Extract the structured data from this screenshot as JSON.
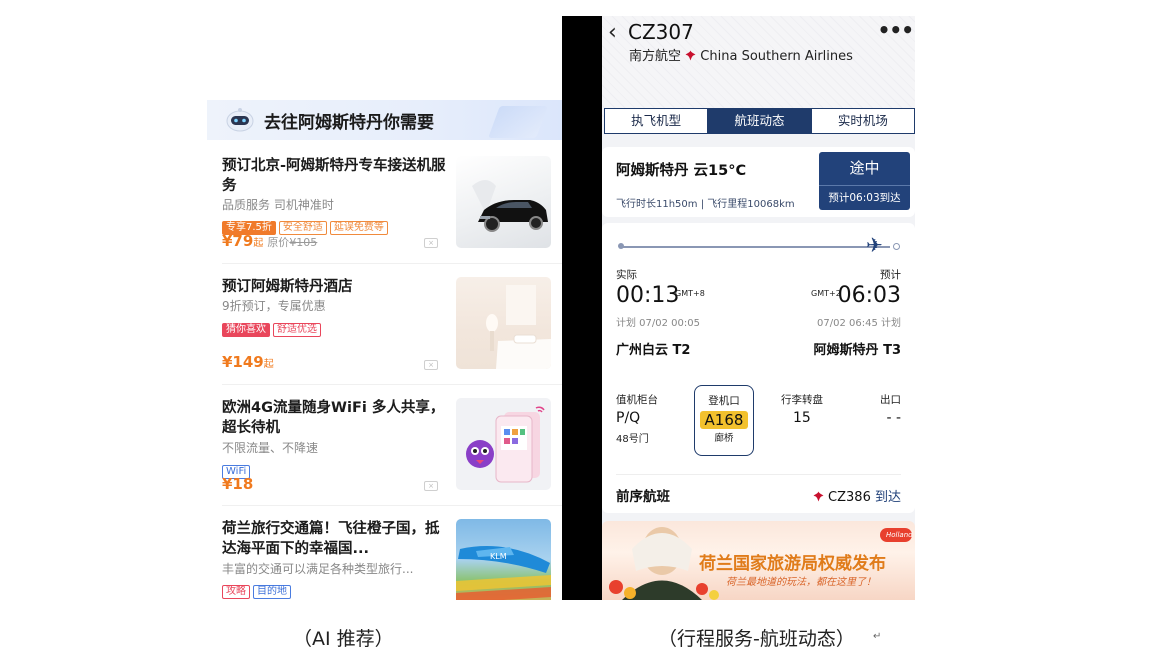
{
  "left": {
    "header_title": "去往阿姆斯特丹你需要",
    "items": [
      {
        "title": "预订北京-阿姆斯特丹专车接送机服务",
        "subtitle": "品质服务 司机神准时",
        "tags": [
          "专享7.5折",
          "安全舒适",
          "延误免费等"
        ],
        "price": "¥79",
        "price_suffix": "起",
        "old_price_label": "原价",
        "old_price": "¥105"
      },
      {
        "title": "预订阿姆斯特丹酒店",
        "subtitle": "9折预订，专属优惠",
        "tags": [
          "猜你喜欢",
          "舒适优选"
        ],
        "price": "¥149",
        "price_suffix": "起"
      },
      {
        "title": "欧洲4G流量随身WiFi 多人共享，超长待机",
        "subtitle": "不限流量、不降速",
        "tags": [
          "WiFi"
        ],
        "price": "¥18"
      },
      {
        "title": "荷兰旅行交通篇！飞往橙子国，抵达海平面下的幸福国...",
        "subtitle": "丰富的交通可以满足各种类型旅行...",
        "tags": [
          "攻略",
          "目的地"
        ],
        "thumb_text": "KLM"
      }
    ],
    "close_glyph": "×"
  },
  "right": {
    "back_icon": "‹",
    "flight_no": "CZ307",
    "airline_cn": "南方航空",
    "airline_en": "China Southern Airlines",
    "more_icon": "•••",
    "tabs": [
      {
        "label": "执飞机型",
        "active": false
      },
      {
        "label": "航班动态",
        "active": true
      },
      {
        "label": "实时机场",
        "active": false
      }
    ],
    "destination_weather": "阿姆斯特丹 云15°C",
    "flight_meta": "飞行时长11h50m  |  飞行里程10068km",
    "status": "途中",
    "eta": "预计06:03到达",
    "plane_icon": "✈",
    "dep": {
      "label": "实际",
      "time": "00:13",
      "gmt": "GMT+8",
      "scheduled": "计划 07/02 00:05",
      "airport": "广州白云 T2"
    },
    "arr": {
      "label": "预计",
      "time": "06:03",
      "gmt": "GMT+2",
      "scheduled": "07/02 06:45 计划",
      "airport": "阿姆斯特丹 T3"
    },
    "checkin": {
      "label": "值机柜台",
      "value": "P/Q",
      "sub": "48号门"
    },
    "gate": {
      "label": "登机口",
      "value": "A168",
      "sub": "廊桥"
    },
    "baggage": {
      "label": "行李转盘",
      "value": "15"
    },
    "exit": {
      "label": "出口",
      "value": "- -"
    },
    "prev_flight": {
      "label": "前序航班",
      "flight": "CZ386",
      "status": "到达"
    },
    "banner": {
      "brand": "Holland",
      "title": "荷兰国家旅游局权威发布",
      "subtitle": "荷兰最地道的玩法，都在这里了！"
    }
  },
  "captions": {
    "left": "（AI 推荐）",
    "right": "（行程服务-航班动态）",
    "right_mark": "↵"
  },
  "colors": {
    "navy": "#1f3b6b",
    "price_orange": "#f07a1e",
    "gate_yellow": "#f2c12e",
    "airline_red": "#c8102e"
  }
}
